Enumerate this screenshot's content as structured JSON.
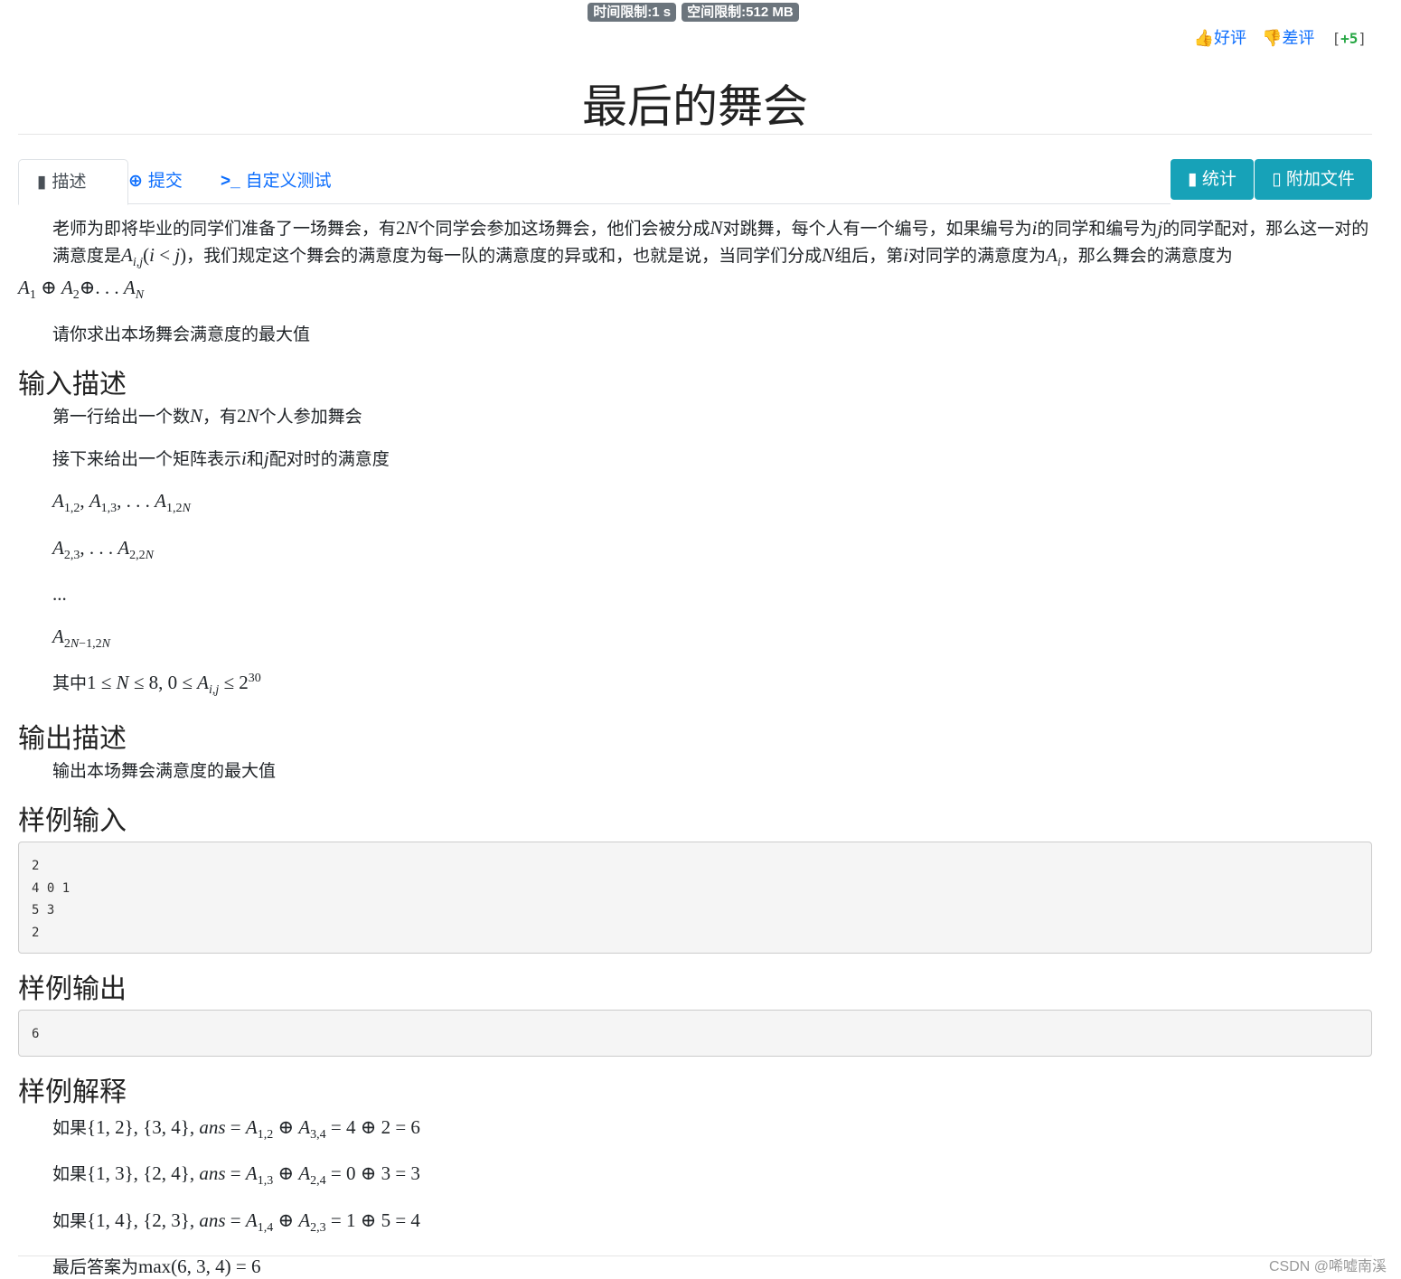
{
  "header": {
    "time_limit": "时间限制:1 s",
    "memory_limit": "空间限制:512 MB",
    "good_label": "好评",
    "bad_label": "差评",
    "score": "+5",
    "title": "最后的舞会"
  },
  "tabs": [
    {
      "label": "描述",
      "icon": "book-icon"
    },
    {
      "label": "提交",
      "icon": "upload-circle-icon"
    },
    {
      "label": "自定义测试",
      "icon": "terminal-icon"
    }
  ],
  "actions": {
    "stats_label": "统计",
    "files_label": "附加文件"
  },
  "description": {
    "p1_a": "老师为即将毕业的同学们准备了一场舞会，有",
    "p1_b": "个同学会参加这场舞会，他们会被分成",
    "p1_c": "对跳舞，每个人有一个编号，如果编号为",
    "p1_d": "的同学和编号为",
    "p1_e": "的同学配对，那么这一对的满意度是",
    "p1_f": "，我们规定这个舞会的满意度为每一队的满意度的异或和，也就是说，当同学们分成",
    "p1_g": "组后，第",
    "p1_h": "对同学的满意度为",
    "p1_i": "，那么舞会的满意度为",
    "p2": "请你求出本场舞会满意度的最大值"
  },
  "input_section": {
    "heading": "输入描述",
    "line1_a": "第一行给出一个数",
    "line1_b": "，有",
    "line1_c": "个人参加舞会",
    "line2_a": "接下来给出一个矩阵表示",
    "line2_b": "和",
    "line2_c": "配对时的满意度",
    "ellipsis": "...",
    "constraint_a": "其中"
  },
  "output_section": {
    "heading": "输出描述",
    "line": "输出本场舞会满意度的最大值"
  },
  "sample_input": {
    "heading": "样例输入",
    "code": "2\n4 0 1\n5 3\n2"
  },
  "sample_output": {
    "heading": "样例输出",
    "code": "6"
  },
  "explanation": {
    "heading": "样例解释",
    "prefix": "如果",
    "final_prefix": "最后答案为"
  },
  "watermark": "CSDN @唏嘘南溪"
}
